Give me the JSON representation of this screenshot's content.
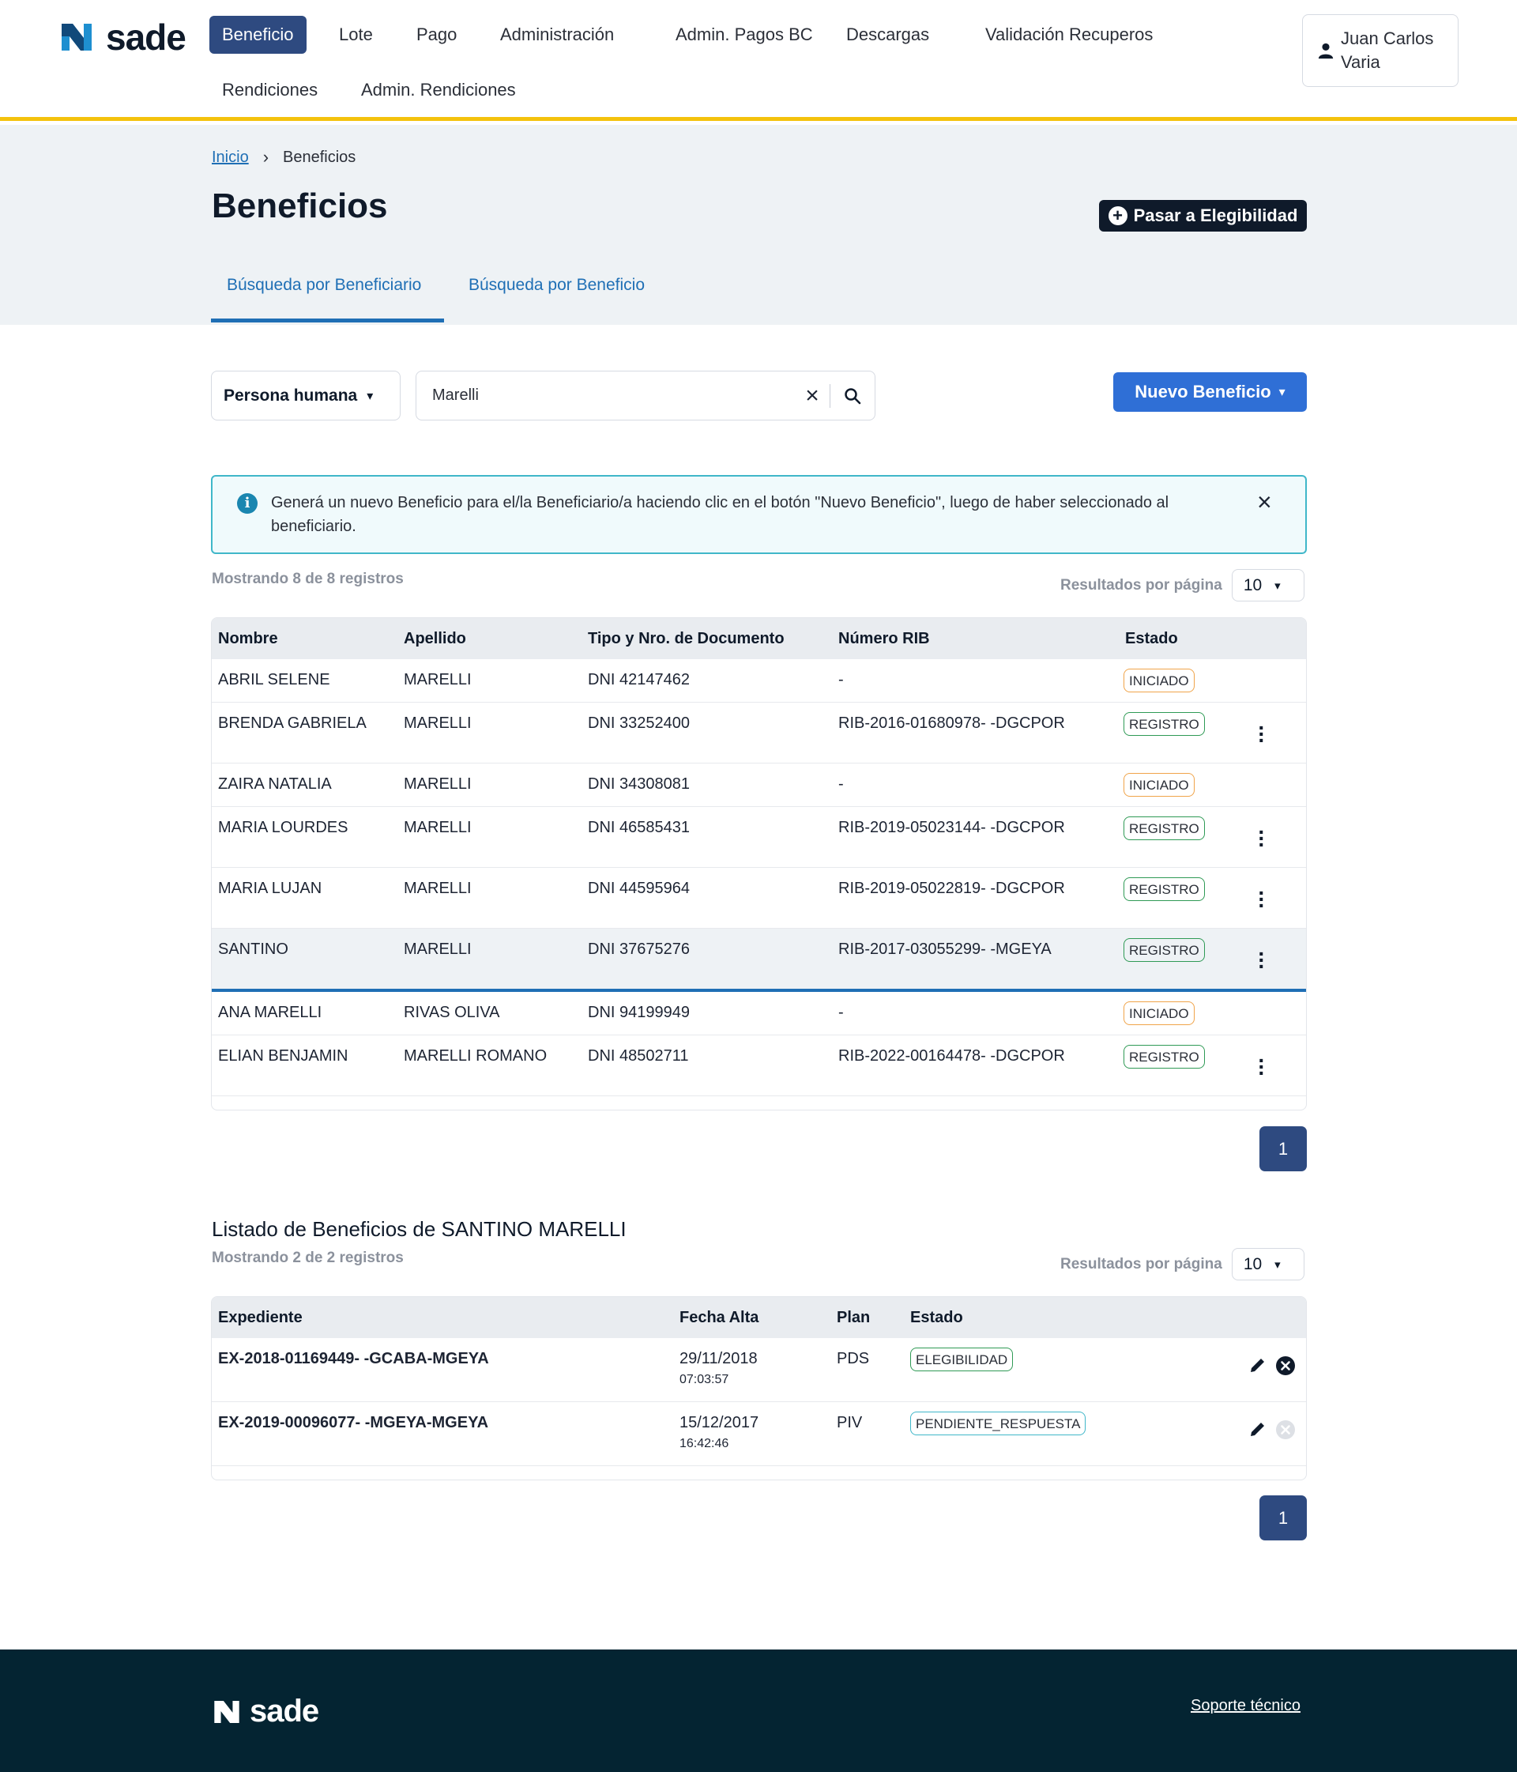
{
  "brand": {
    "name": "sade"
  },
  "nav": {
    "items": [
      {
        "label": "Beneficio",
        "active": true
      },
      {
        "label": "Lote"
      },
      {
        "label": "Pago"
      },
      {
        "label": "Administración"
      },
      {
        "label": "Admin. Pagos BC"
      },
      {
        "label": "Descargas"
      },
      {
        "label": "Validación Recuperos"
      },
      {
        "label": "Rendiciones"
      },
      {
        "label": "Admin. Rendiciones"
      }
    ]
  },
  "user": {
    "name": "Juan Carlos Varia",
    "icon": "user-icon"
  },
  "breadcrumb": {
    "home": "Inicio",
    "current": "Beneficios"
  },
  "page": {
    "title": "Beneficios",
    "elig_button": "Pasar a Elegibilidad",
    "tabs": [
      {
        "label": "Búsqueda por Beneficiario",
        "active": true
      },
      {
        "label": "Búsqueda por Beneficio",
        "active": false
      }
    ]
  },
  "search": {
    "person_type": "Persona humana",
    "query": "Marelli",
    "new_button": "Nuevo Beneficio"
  },
  "alert": {
    "message": "Generá un nuevo Beneficio para el/la Beneficiario/a haciendo clic en el botón \"Nuevo Beneficio\", luego de haber seleccionado al beneficiario."
  },
  "beneficiaries": {
    "count_text": "Mostrando 8 de 8 registros",
    "per_page_label": "Resultados por página",
    "per_page": "10",
    "columns": [
      "Nombre",
      "Apellido",
      "Tipo y Nro. de Documento",
      "Número RIB",
      "Estado"
    ],
    "rows": [
      {
        "nombre": "ABRIL SELENE",
        "apellido": "MARELLI",
        "doc": "DNI 42147462",
        "rib": "-",
        "estado": "INICIADO",
        "menu": false
      },
      {
        "nombre": "BRENDA GABRIELA",
        "apellido": "MARELLI",
        "doc": "DNI 33252400",
        "rib": "RIB-2016-01680978- -DGCPOR",
        "estado": "REGISTRO",
        "menu": true
      },
      {
        "nombre": "ZAIRA NATALIA",
        "apellido": "MARELLI",
        "doc": "DNI 34308081",
        "rib": "-",
        "estado": "INICIADO",
        "menu": false
      },
      {
        "nombre": "MARIA LOURDES",
        "apellido": "MARELLI",
        "doc": "DNI 46585431",
        "rib": "RIB-2019-05023144- -DGCPOR",
        "estado": "REGISTRO",
        "menu": true
      },
      {
        "nombre": "MARIA LUJAN",
        "apellido": "MARELLI",
        "doc": "DNI 44595964",
        "rib": "RIB-2019-05022819- -DGCPOR",
        "estado": "REGISTRO",
        "menu": true
      },
      {
        "nombre": "SANTINO",
        "apellido": "MARELLI",
        "doc": "DNI 37675276",
        "rib": "RIB-2017-03055299- -MGEYA",
        "estado": "REGISTRO",
        "menu": true,
        "selected": true
      },
      {
        "nombre": "ANA MARELLI",
        "apellido": "RIVAS OLIVA",
        "doc": "DNI 94199949",
        "rib": "-",
        "estado": "INICIADO",
        "menu": false
      },
      {
        "nombre": "ELIAN BENJAMIN",
        "apellido": "MARELLI ROMANO",
        "doc": "DNI 48502711",
        "rib": "RIB-2022-00164478- -DGCPOR",
        "estado": "REGISTRO",
        "menu": true
      }
    ],
    "page": "1"
  },
  "benefits": {
    "title": "Listado de Beneficios de SANTINO MARELLI",
    "count_text": "Mostrando 2 de 2 registros",
    "per_page_label": "Resultados por página",
    "per_page": "10",
    "columns": [
      "Expediente",
      "Fecha Alta",
      "Plan",
      "Estado"
    ],
    "rows": [
      {
        "expediente": "EX-2018-01169449- -GCABA-MGEYA",
        "fecha": "29/11/2018",
        "hora": "07:03:57",
        "plan": "PDS",
        "estado": "ELEGIBILIDAD",
        "cancel_enabled": true
      },
      {
        "expediente": "EX-2019-00096077- -MGEYA-MGEYA",
        "fecha": "15/12/2017",
        "hora": "16:42:46",
        "plan": "PIV",
        "estado": "PENDIENTE_RESPUESTA",
        "cancel_enabled": false
      }
    ],
    "page": "1"
  },
  "footer": {
    "brand": "sade",
    "support": "Soporte técnico"
  },
  "colors": {
    "accent": "#2e4a80",
    "primary": "#2f6fd6",
    "link": "#1f6fb5",
    "yellow": "#f4c20d",
    "footer": "#042432"
  }
}
